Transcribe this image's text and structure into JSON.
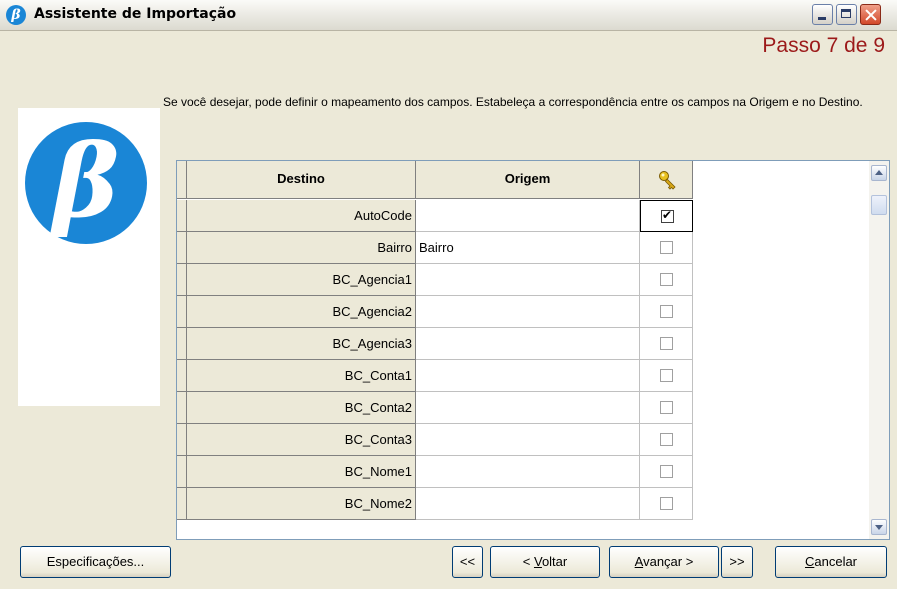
{
  "window": {
    "title": "Assistente de Importação",
    "icon": "beta-logo-icon"
  },
  "step": "Passo 7 de 9",
  "description": "Se você desejar, pode definir o mapeamento dos campos. Estabeleça a correspondência entre os campos na Origem e no Destino.",
  "grid": {
    "headers": {
      "destino": "Destino",
      "origem": "Origem",
      "key": "key-icon"
    },
    "rows": [
      {
        "destino": "AutoCode",
        "origem": "",
        "key": true
      },
      {
        "destino": "Bairro",
        "origem": "Bairro",
        "key": false
      },
      {
        "destino": "BC_Agencia1",
        "origem": "",
        "key": false
      },
      {
        "destino": "BC_Agencia2",
        "origem": "",
        "key": false
      },
      {
        "destino": "BC_Agencia3",
        "origem": "",
        "key": false
      },
      {
        "destino": "BC_Conta1",
        "origem": "",
        "key": false
      },
      {
        "destino": "BC_Conta2",
        "origem": "",
        "key": false
      },
      {
        "destino": "BC_Conta3",
        "origem": "",
        "key": false
      },
      {
        "destino": "BC_Nome1",
        "origem": "",
        "key": false
      },
      {
        "destino": "BC_Nome2",
        "origem": "",
        "key": false
      }
    ]
  },
  "buttons": {
    "especificacoes": "Especificações...",
    "first": "<<",
    "voltar_prefix": "< ",
    "voltar_u": "V",
    "voltar_rest": "oltar",
    "avancar_u": "A",
    "avancar_rest": "vançar >",
    "last": ">>",
    "cancelar_u": "C",
    "cancelar_rest": "ancelar"
  },
  "colors": {
    "step": "#9c1a1a",
    "logo": "#1a86d6"
  }
}
